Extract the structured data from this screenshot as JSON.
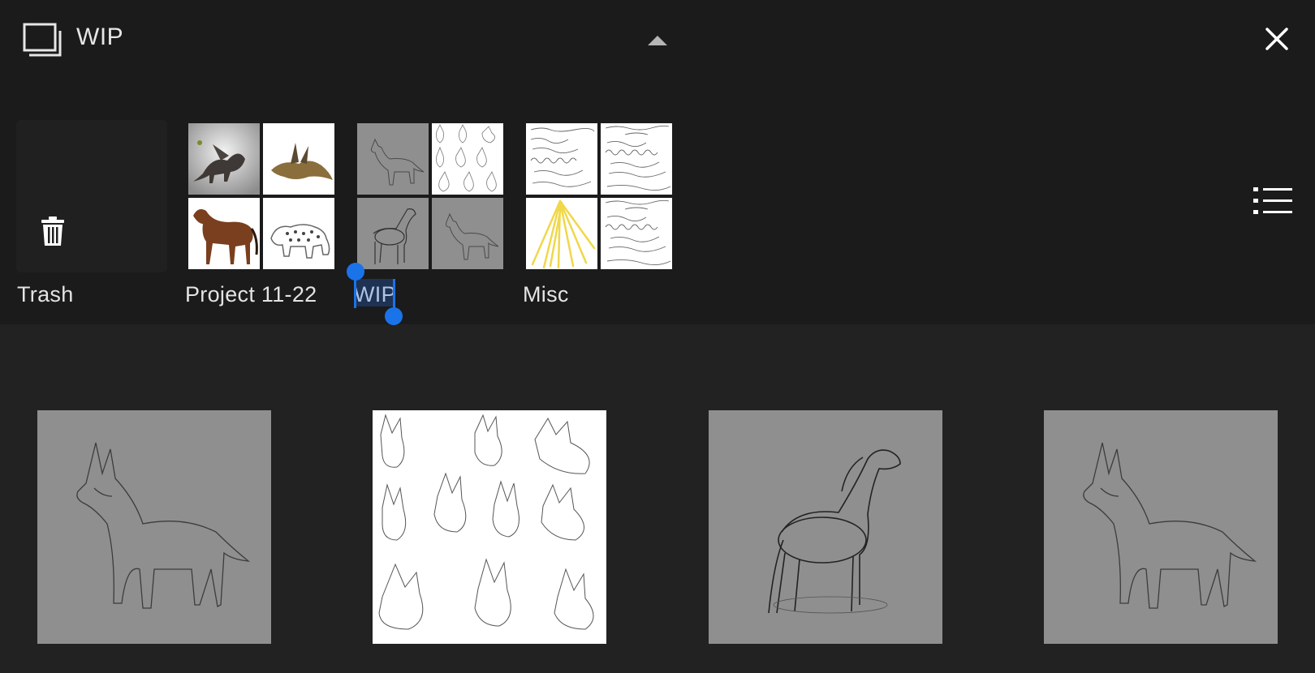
{
  "header": {
    "title": "WIP",
    "icon": "stack-icon",
    "collapse_icon": "chevron-up-icon",
    "close_icon": "close-icon",
    "list_view_icon": "list-view-icon"
  },
  "folders": [
    {
      "label": "Trash",
      "icon": "trash-icon"
    },
    {
      "label": "Project 11-22"
    },
    {
      "label": "WIP",
      "selected": true
    },
    {
      "label": "Misc"
    }
  ],
  "selection_color": "#1a73e8",
  "artworks_count_visible": 4
}
